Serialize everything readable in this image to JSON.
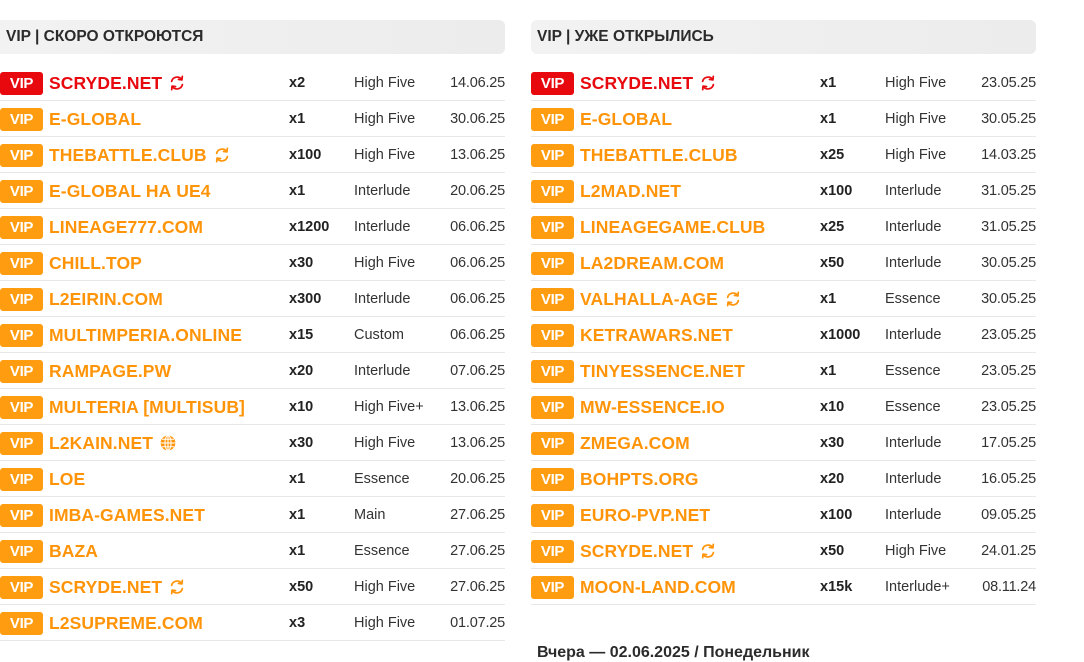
{
  "colors": {
    "vip_top": "#e8090f",
    "vip": "#ff9c0f",
    "name_top": "#e8090f",
    "name": "#ff9408",
    "refresh_icon": "#ff9408",
    "refresh_icon_top": "#e8090f",
    "globe_icon": "#ff9408"
  },
  "left": {
    "title": "VIP | СКОРО ОТКРОЮТСЯ",
    "rows": [
      {
        "vip": "VIP",
        "name": "SCRYDE.NET",
        "icon": "refresh-icon",
        "rate": "x2",
        "chronicle": "High Five",
        "date": "14.06.25",
        "top": true
      },
      {
        "vip": "VIP",
        "name": "E-GLOBAL",
        "icon": "",
        "rate": "x1",
        "chronicle": "High Five",
        "date": "30.06.25"
      },
      {
        "vip": "VIP",
        "name": "THEBATTLE.CLUB",
        "icon": "refresh-icon",
        "rate": "x100",
        "chronicle": "High Five",
        "date": "13.06.25"
      },
      {
        "vip": "VIP",
        "name": "E-GLOBAL НА UE4",
        "icon": "",
        "rate": "x1",
        "chronicle": "Interlude",
        "date": "20.06.25"
      },
      {
        "vip": "VIP",
        "name": "LINEAGE777.COM",
        "icon": "",
        "rate": "x1200",
        "chronicle": "Interlude",
        "date": "06.06.25"
      },
      {
        "vip": "VIP",
        "name": "CHILL.TOP",
        "icon": "",
        "rate": "x30",
        "chronicle": "High Five",
        "date": "06.06.25"
      },
      {
        "vip": "VIP",
        "name": "L2EIRIN.COM",
        "icon": "",
        "rate": "x300",
        "chronicle": "Interlude",
        "date": "06.06.25"
      },
      {
        "vip": "VIP",
        "name": "MULTIMPERIA.ONLINE",
        "icon": "",
        "rate": "x15",
        "chronicle": "Custom",
        "date": "06.06.25"
      },
      {
        "vip": "VIP",
        "name": "RAMPAGE.PW",
        "icon": "",
        "rate": "x20",
        "chronicle": "Interlude",
        "date": "07.06.25"
      },
      {
        "vip": "VIP",
        "name": "MULTERIA [MULTISUB]",
        "icon": "",
        "rate": "x10",
        "chronicle": "High Five+",
        "date": "13.06.25"
      },
      {
        "vip": "VIP",
        "name": "L2KAIN.NET",
        "icon": "globe-icon",
        "rate": "x30",
        "chronicle": "High Five",
        "date": "13.06.25"
      },
      {
        "vip": "VIP",
        "name": "LOE",
        "icon": "",
        "rate": "x1",
        "chronicle": "Essence",
        "date": "20.06.25"
      },
      {
        "vip": "VIP",
        "name": "IMBA-GAMES.NET",
        "icon": "",
        "rate": "x1",
        "chronicle": "Main",
        "date": "27.06.25"
      },
      {
        "vip": "VIP",
        "name": "BAZA",
        "icon": "",
        "rate": "x1",
        "chronicle": "Essence",
        "date": "27.06.25"
      },
      {
        "vip": "VIP",
        "name": "SCRYDE.NET",
        "icon": "refresh-icon",
        "rate": "x50",
        "chronicle": "High Five",
        "date": "27.06.25"
      },
      {
        "vip": "VIP",
        "name": "L2SUPREME.COM",
        "icon": "",
        "rate": "x3",
        "chronicle": "High Five",
        "date": "01.07.25"
      }
    ]
  },
  "right": {
    "title": "VIP | УЖЕ ОТКРЫЛИСЬ",
    "rows": [
      {
        "vip": "VIP",
        "name": "SCRYDE.NET",
        "icon": "refresh-icon",
        "rate": "x1",
        "chronicle": "High Five",
        "date": "23.05.25",
        "top": true
      },
      {
        "vip": "VIP",
        "name": "E-GLOBAL",
        "icon": "",
        "rate": "x1",
        "chronicle": "High Five",
        "date": "30.05.25"
      },
      {
        "vip": "VIP",
        "name": "THEBATTLE.CLUB",
        "icon": "",
        "rate": "x25",
        "chronicle": "High Five",
        "date": "14.03.25"
      },
      {
        "vip": "VIP",
        "name": "L2MAD.NET",
        "icon": "",
        "rate": "x100",
        "chronicle": "Interlude",
        "date": "31.05.25"
      },
      {
        "vip": "VIP",
        "name": "LINEAGEGAME.CLUB",
        "icon": "",
        "rate": "x25",
        "chronicle": "Interlude",
        "date": "31.05.25"
      },
      {
        "vip": "VIP",
        "name": "LA2DREAM.COM",
        "icon": "",
        "rate": "x50",
        "chronicle": "Interlude",
        "date": "30.05.25"
      },
      {
        "vip": "VIP",
        "name": "VALHALLA-AGE",
        "icon": "refresh-icon",
        "rate": "x1",
        "chronicle": "Essence",
        "date": "30.05.25"
      },
      {
        "vip": "VIP",
        "name": "KETRAWARS.NET",
        "icon": "",
        "rate": "x1000",
        "chronicle": "Interlude",
        "date": "23.05.25"
      },
      {
        "vip": "VIP",
        "name": "TINYESSENCE.NET",
        "icon": "",
        "rate": "x1",
        "chronicle": "Essence",
        "date": "23.05.25"
      },
      {
        "vip": "VIP",
        "name": "MW-ESSENCE.IO",
        "icon": "",
        "rate": "x10",
        "chronicle": "Essence",
        "date": "23.05.25"
      },
      {
        "vip": "VIP",
        "name": "ZMEGA.COM",
        "icon": "",
        "rate": "x30",
        "chronicle": "Interlude",
        "date": "17.05.25"
      },
      {
        "vip": "VIP",
        "name": "BOHPTS.ORG",
        "icon": "",
        "rate": "x20",
        "chronicle": "Interlude",
        "date": "16.05.25"
      },
      {
        "vip": "VIP",
        "name": "EURO-PVP.NET",
        "icon": "",
        "rate": "x100",
        "chronicle": "Interlude",
        "date": "09.05.25"
      },
      {
        "vip": "VIP",
        "name": "SCRYDE.NET",
        "icon": "refresh-icon",
        "rate": "x50",
        "chronicle": "High Five",
        "date": "24.01.25"
      },
      {
        "vip": "VIP",
        "name": "MOON-LAND.COM",
        "icon": "",
        "rate": "x15k",
        "chronicle": "Interlude+",
        "date": "08.11.24"
      }
    ]
  },
  "yesterday_heading": "Вчера — 02.06.2025 / Понедельник"
}
